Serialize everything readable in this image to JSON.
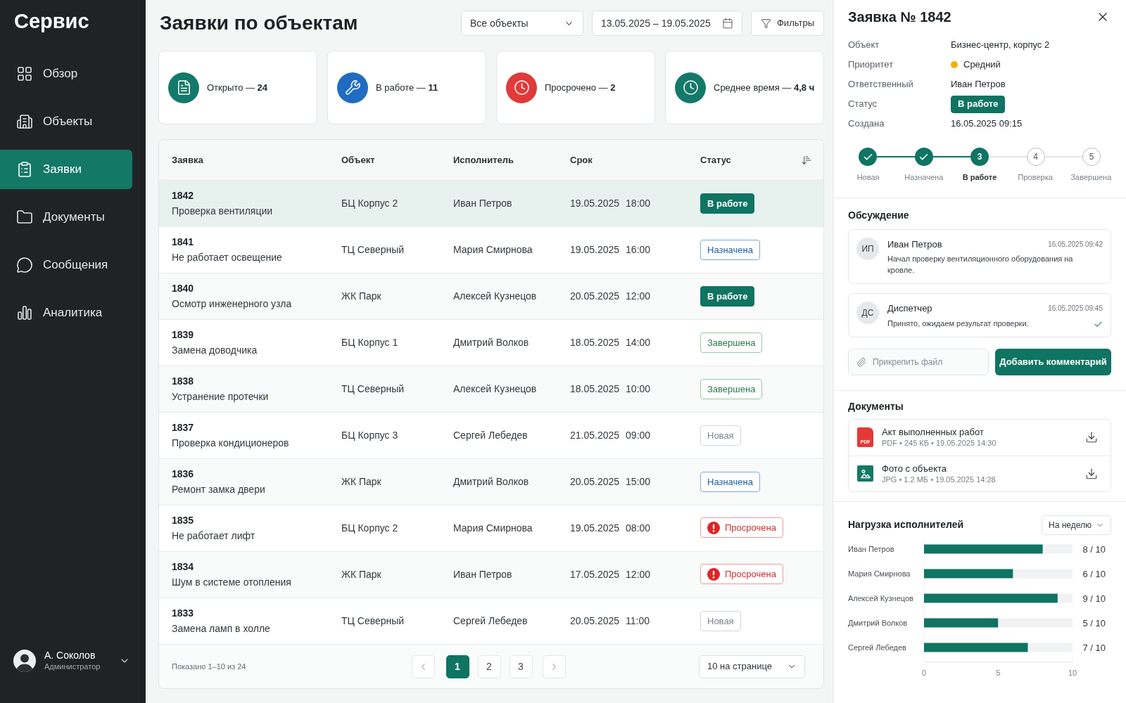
{
  "sidebar": {
    "title": "Сервис",
    "items": [
      {
        "label": "Обзор",
        "selected": false
      },
      {
        "label": "Объекты",
        "selected": false
      },
      {
        "label": "Заявки",
        "selected": true
      },
      {
        "label": "Документы",
        "selected": false
      },
      {
        "label": "Сообщения",
        "selected": false
      },
      {
        "label": "Аналитика",
        "selected": false
      }
    ],
    "user": {
      "name": "А. Соколов",
      "role": "Администратор"
    }
  },
  "header": {
    "title": "Заявки по объектам",
    "object_select": "Все объекты",
    "date_range": "13.05.2025 – 19.05.2025",
    "filters_button": "Фильтры"
  },
  "stats": [
    {
      "text": "Открыто — **24**",
      "color": "#13796a"
    },
    {
      "text": "В работе — **11**",
      "color": "#1f6cc2"
    },
    {
      "text": "Просрочено — **2**",
      "color": "#e03a3a"
    },
    {
      "text": "Среднее время — **4,8 ч**",
      "color": "#13796a"
    }
  ],
  "table": {
    "columns": [
      "Заявка",
      "Объект",
      "Исполнитель",
      "Срок",
      "Статус"
    ],
    "rows": [
      {
        "id": "1842",
        "title": "Проверка вентиляции",
        "object": "БЦ Корпус 2",
        "assignee": "Иван Петров",
        "due_date": "19.05.2025",
        "due_time": "18:00",
        "status": {
          "label": "В работе",
          "kind": "in_progress"
        },
        "selected": true
      },
      {
        "id": "1841",
        "title": "Не работает освещение",
        "object": "ТЦ Северный",
        "assignee": "Мария Смирнова",
        "due_date": "19.05.2025",
        "due_time": "16:00",
        "status": {
          "label": "Назначена",
          "kind": "assigned"
        },
        "selected": false
      },
      {
        "id": "1840",
        "title": "Осмотр инженерного узла",
        "object": "ЖК Парк",
        "assignee": "Алексей Кузнецов",
        "due_date": "20.05.2025",
        "due_time": "12:00",
        "status": {
          "label": "В работе",
          "kind": "in_progress"
        },
        "selected": false
      },
      {
        "id": "1839",
        "title": "Замена доводчика",
        "object": "БЦ Корпус 1",
        "assignee": "Дмитрий Волков",
        "due_date": "18.05.2025",
        "due_time": "14:00",
        "status": {
          "label": "Завершена",
          "kind": "done"
        },
        "selected": false
      },
      {
        "id": "1838",
        "title": "Устранение протечки",
        "object": "ТЦ Северный",
        "assignee": "Алексей Кузнецов",
        "due_date": "18.05.2025",
        "due_time": "10:00",
        "status": {
          "label": "Завершена",
          "kind": "done"
        },
        "selected": false
      },
      {
        "id": "1837",
        "title": "Проверка кондиционеров",
        "object": "БЦ Корпус 3",
        "assignee": "Сергей Лебедев",
        "due_date": "21.05.2025",
        "due_time": "09:00",
        "status": {
          "label": "Новая",
          "kind": "new"
        },
        "selected": false
      },
      {
        "id": "1836",
        "title": "Ремонт замка двери",
        "object": "ЖК Парк",
        "assignee": "Дмитрий Волков",
        "due_date": "20.05.2025",
        "due_time": "15:00",
        "status": {
          "label": "Назначена",
          "kind": "assigned"
        },
        "selected": false
      },
      {
        "id": "1835",
        "title": "Не работает лифт",
        "object": "БЦ Корпус 2",
        "assignee": "Мария Смирнова",
        "due_date": "19.05.2025",
        "due_time": "08:00",
        "status": {
          "label": "Просрочена",
          "kind": "overdue"
        },
        "selected": false
      },
      {
        "id": "1834",
        "title": "Шум в системе отопления",
        "object": "ЖК Парк",
        "assignee": "Иван Петров",
        "due_date": "17.05.2025",
        "due_time": "12:00",
        "status": {
          "label": "Просрочена",
          "kind": "overdue"
        },
        "selected": false
      },
      {
        "id": "1833",
        "title": "Замена ламп в холле",
        "object": "ТЦ Северный",
        "assignee": "Сергей Лебедев",
        "due_date": "20.05.2025",
        "due_time": "11:00",
        "status": {
          "label": "Новая",
          "kind": "new"
        },
        "selected": false
      }
    ],
    "footer": {
      "summary": "Показано 1–10 из 24",
      "pages": [
        {
          "label": "1",
          "selected": true
        },
        {
          "label": "2",
          "selected": false
        },
        {
          "label": "3",
          "selected": false
        }
      ],
      "page_size": "10 на странице"
    }
  },
  "ticket": {
    "title": "Заявка № 1842",
    "details": [
      {
        "label": "Объект",
        "kind": "text",
        "value": "Бизнес-центр, корпус 2"
      },
      {
        "label": "Приоритет",
        "kind": "dot",
        "value": "Средний",
        "color": "#f5b000"
      },
      {
        "label": "Ответственный",
        "kind": "text",
        "value": "Иван Петров"
      },
      {
        "label": "Статус",
        "kind": "badge",
        "status": {
          "label": "В работе",
          "kind": "in_progress"
        }
      },
      {
        "label": "Создана",
        "kind": "text",
        "value": "16.05.2025 09:15"
      }
    ],
    "steps": [
      {
        "label": "Новая",
        "kind": "done"
      },
      {
        "label": "Назначена",
        "kind": "done"
      },
      {
        "label": "В работе",
        "number": "3",
        "kind": "current"
      },
      {
        "label": "Проверка",
        "number": "4",
        "kind": "pending"
      },
      {
        "label": "Завершена",
        "number": "5",
        "kind": "pending"
      }
    ],
    "discussion": {
      "title": "Обсуждение",
      "comments": [
        {
          "initials": "ИП",
          "author": "Иван Петров",
          "time": "16.05.2025 09:42",
          "text": "Начал проверку вентиляционного оборудования на кровле.",
          "read": false
        },
        {
          "initials": "ДС",
          "author": "Диспетчер",
          "time": "16.05.2025 09:45",
          "text": "Принято, ожидаем результат проверки.",
          "read": true
        }
      ],
      "attach_placeholder": "Прикрепить файл",
      "submit_button": "Добавить комментарий"
    },
    "documents": {
      "title": "Документы",
      "items": [
        {
          "kind": "pdf",
          "icon_label": "PDF",
          "name": "Акт выполненных работ",
          "meta": "PDF • 245 КБ • 19.05.2025 14:30"
        },
        {
          "kind": "image",
          "name": "Фото с объекта",
          "meta": "JPG • 1.2 МБ • 19.05.2025 14:28"
        }
      ]
    },
    "workload": {
      "period": "На неделю",
      "readings": [
        "8 / 10",
        "6 / 10",
        "9 / 10",
        "5 / 10",
        "7 / 10"
      ],
      "chart_data": {
        "type": "bar",
        "orientation": "horizontal",
        "title": "Нагрузка исполнителей",
        "categories": [
          "Иван Петров",
          "Мария Смирнова",
          "Алексей Кузнецов",
          "Дмитрий Волков",
          "Сергей Лебедев"
        ],
        "series": [
          {
            "color": "#0f7462",
            "values": [
              8,
              6,
              9,
              5,
              7
            ]
          },
          {
            "color": "#f1f2f3",
            "values": [
              2,
              4,
              1,
              5,
              3
            ]
          }
        ],
        "stacked": true,
        "xlim": [
          0,
          10
        ],
        "xticks": [
          {
            "value": 0,
            "label": "0"
          },
          {
            "value": 5,
            "label": "5"
          },
          {
            "value": 10,
            "label": "10"
          }
        ]
      }
    }
  }
}
